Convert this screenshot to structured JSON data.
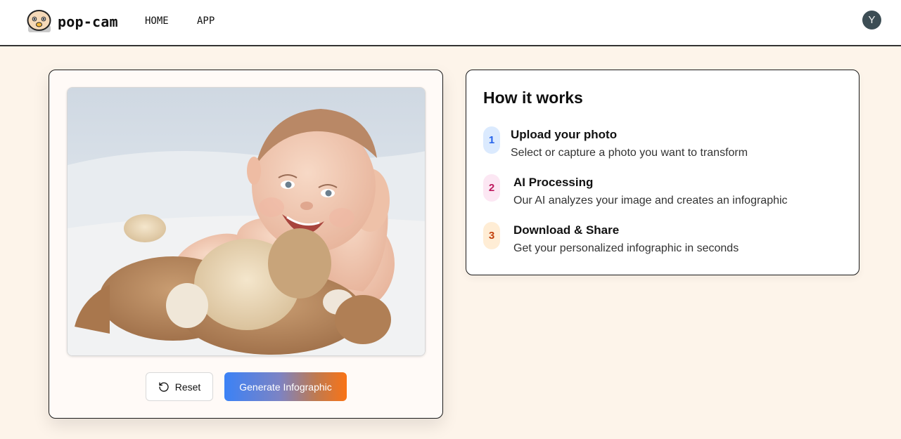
{
  "brand": {
    "name": "pop-cam"
  },
  "nav": {
    "items": [
      {
        "label": "HOME"
      },
      {
        "label": "APP"
      }
    ]
  },
  "user": {
    "avatar_initial": "Y"
  },
  "upload": {
    "reset_label": "Reset",
    "generate_label": "Generate Infographic"
  },
  "how_it_works": {
    "title": "How it works",
    "steps": [
      {
        "number": "1",
        "title": "Upload your photo",
        "description": "Select or capture a photo you want to transform"
      },
      {
        "number": "2",
        "title": "AI Processing",
        "description": "Our AI analyzes your image and creates an infographic"
      },
      {
        "number": "3",
        "title": "Download & Share",
        "description": "Get your personalized infographic in seconds"
      }
    ]
  },
  "colors": {
    "page_background": "#fdf4ea",
    "accent_blue": "#3b82f6",
    "accent_orange": "#f97316",
    "avatar": "#3c4d54"
  },
  "icons": {
    "logo": "cartoon-face-icon",
    "reset": "rotate-ccw-icon"
  }
}
